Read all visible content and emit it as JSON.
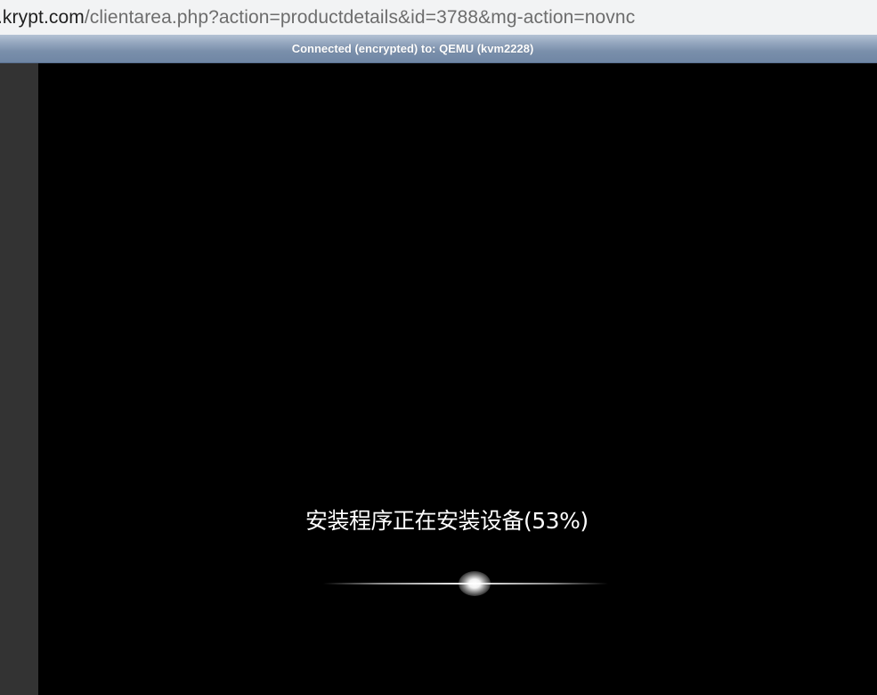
{
  "browser": {
    "url_domain": ".krypt.com",
    "url_path": "/clientarea.php?action=productdetails&id=3788&mg-action=novnc"
  },
  "vnc": {
    "status_text": "Connected (encrypted) to: QEMU (kvm2228)"
  },
  "screen": {
    "install_message": "安装程序正在安装设备(53%)",
    "progress_percent": 53
  },
  "colors": {
    "status_bar": "#7a8fab",
    "side_strip": "#333333",
    "screen_bg": "#000000",
    "text": "#ffffff"
  }
}
